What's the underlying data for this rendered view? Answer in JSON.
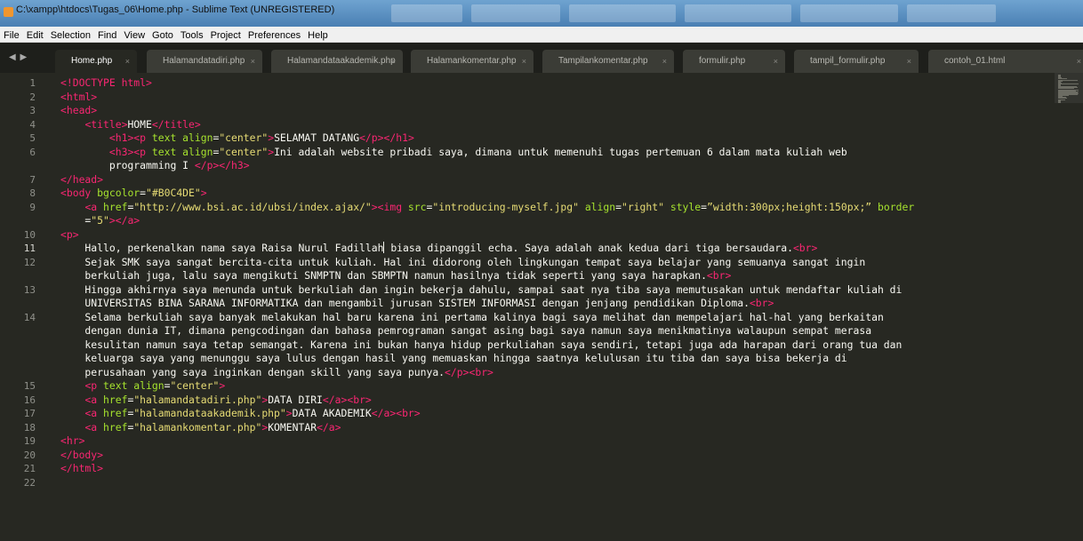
{
  "window": {
    "title": "C:\\xampp\\htdocs\\Tugas_06\\Home.php - Sublime Text (UNREGISTERED)"
  },
  "menu": [
    "File",
    "Edit",
    "Selection",
    "Find",
    "View",
    "Goto",
    "Tools",
    "Project",
    "Preferences",
    "Help"
  ],
  "tabs": [
    {
      "label": "Home.php",
      "active": true
    },
    {
      "label": "Halamandatadiri.php"
    },
    {
      "label": "Halamandataakademik.php"
    },
    {
      "label": "Halamankomentar.php"
    },
    {
      "label": "Tampilankomentar.php"
    },
    {
      "label": "formulir.php"
    },
    {
      "label": "tampil_formulir.php"
    },
    {
      "label": "contoh_01.html"
    }
  ],
  "tab_close_glyph": "×",
  "tab_nav_glyph": "◀ ▶",
  "gutter": [
    "1",
    "2",
    "3",
    "4",
    "5",
    "6",
    "",
    "7",
    "8",
    "9",
    "",
    "10",
    "11",
    "12",
    "",
    "13",
    "",
    "14",
    "",
    "",
    "",
    "",
    "15",
    "16",
    "17",
    "18",
    "19",
    "20",
    "21",
    "22"
  ],
  "current_line": "11",
  "code": [
    [
      [
        "tag",
        "<!DOCTYPE html>"
      ]
    ],
    [
      [
        "tag",
        "<html>"
      ]
    ],
    [
      [
        "tag",
        "<head>"
      ]
    ],
    [
      [
        "txt",
        "    "
      ],
      [
        "tag",
        "<title>"
      ],
      [
        "txt",
        "HOME"
      ],
      [
        "tag",
        "</title>"
      ]
    ],
    [
      [
        "txt",
        "        "
      ],
      [
        "tag",
        "<h1><p "
      ],
      [
        "attr",
        "text align"
      ],
      [
        "txt",
        "="
      ],
      [
        "str",
        "\"center\""
      ],
      [
        "tag",
        ">"
      ],
      [
        "txt",
        "SELAMAT DATANG"
      ],
      [
        "tag",
        "</p></h1>"
      ]
    ],
    [
      [
        "txt",
        "        "
      ],
      [
        "tag",
        "<h3><p "
      ],
      [
        "attr",
        "text align"
      ],
      [
        "txt",
        "="
      ],
      [
        "str",
        "\"center\""
      ],
      [
        "tag",
        ">"
      ],
      [
        "txt",
        "Ini adalah website pribadi saya, dimana untuk memenuhi tugas pertemuan 6 dalam mata kuliah web"
      ]
    ],
    [
      [
        "txt",
        "        programming I "
      ],
      [
        "tag",
        "</p></h3>"
      ]
    ],
    [
      [
        "tag",
        "</head>"
      ]
    ],
    [
      [
        "tag",
        "<body "
      ],
      [
        "attr",
        "bgcolor"
      ],
      [
        "txt",
        "="
      ],
      [
        "str",
        "\"#B0C4DE\""
      ],
      [
        "tag",
        ">"
      ]
    ],
    [
      [
        "txt",
        "    "
      ],
      [
        "tag",
        "<a "
      ],
      [
        "attr",
        "href"
      ],
      [
        "txt",
        "="
      ],
      [
        "str",
        "\"http://www.bsi.ac.id/ubsi/index.ajax/\""
      ],
      [
        "tag",
        "><img "
      ],
      [
        "attr",
        "src"
      ],
      [
        "txt",
        "="
      ],
      [
        "str",
        "\"introducing-myself.jpg\""
      ],
      [
        "txt",
        " "
      ],
      [
        "attr",
        "align"
      ],
      [
        "txt",
        "="
      ],
      [
        "str",
        "\"right\""
      ],
      [
        "txt",
        " "
      ],
      [
        "attr",
        "style"
      ],
      [
        "txt",
        "="
      ],
      [
        "str",
        "”width:300px;height:150px;” "
      ],
      [
        "attr",
        "border"
      ]
    ],
    [
      [
        "txt",
        "    ="
      ],
      [
        "str",
        "\"5\""
      ],
      [
        "tag",
        "></a>"
      ]
    ],
    [
      [
        "tag",
        "<p>"
      ]
    ],
    [
      [
        "txt",
        "    Hallo, perkenalkan nama saya Raisa Nurul Fadillah"
      ],
      [
        "cursor",
        ""
      ],
      [
        "txt",
        " biasa dipanggil echa. Saya adalah anak kedua dari tiga bersaudara."
      ],
      [
        "tag",
        "<br>"
      ]
    ],
    [
      [
        "txt",
        "    Sejak SMK saya sangat bercita-cita untuk kuliah. Hal ini didorong oleh lingkungan tempat saya belajar yang semuanya sangat ingin"
      ]
    ],
    [
      [
        "txt",
        "    berkuliah juga, lalu saya mengikuti SNMPTN dan SBMPTN namun hasilnya tidak seperti yang saya harapkan."
      ],
      [
        "tag",
        "<br>"
      ]
    ],
    [
      [
        "txt",
        "    Hingga akhirnya saya menunda untuk berkuliah dan ingin bekerja dahulu, sampai saat nya tiba saya memutusakan untuk mendaftar kuliah di"
      ]
    ],
    [
      [
        "txt",
        "    UNIVERSITAS BINA SARANA INFORMATIKA dan mengambil jurusan SISTEM INFORMASI dengan jenjang pendidikan Diploma."
      ],
      [
        "tag",
        "<br>"
      ]
    ],
    [
      [
        "txt",
        "    Selama berkuliah saya banyak melakukan hal baru karena ini pertama kalinya bagi saya melihat dan mempelajari hal-hal yang berkaitan"
      ]
    ],
    [
      [
        "txt",
        "    dengan dunia IT, dimana pengcodingan dan bahasa pemrograman sangat asing bagi saya namun saya menikmatinya walaupun sempat merasa"
      ]
    ],
    [
      [
        "txt",
        "    kesulitan namun saya tetap semangat. Karena ini bukan hanya hidup perkuliahan saya sendiri, tetapi juga ada harapan dari orang tua dan"
      ]
    ],
    [
      [
        "txt",
        "    keluarga saya yang menunggu saya lulus dengan hasil yang memuaskan hingga saatnya kelulusan itu tiba dan saya bisa bekerja di"
      ]
    ],
    [
      [
        "txt",
        "    perusahaan yang saya inginkan dengan skill yang saya punya."
      ],
      [
        "tag",
        "</p><br>"
      ]
    ],
    [
      [
        "txt",
        "    "
      ],
      [
        "tag",
        "<p "
      ],
      [
        "attr",
        "text align"
      ],
      [
        "txt",
        "="
      ],
      [
        "str",
        "\"center\""
      ],
      [
        "tag",
        ">"
      ]
    ],
    [
      [
        "txt",
        "    "
      ],
      [
        "tag",
        "<a "
      ],
      [
        "attr",
        "href"
      ],
      [
        "txt",
        "="
      ],
      [
        "str",
        "\"halamandatadiri.php\""
      ],
      [
        "tag",
        ">"
      ],
      [
        "txt",
        "DATA DIRI"
      ],
      [
        "tag",
        "</a><br>"
      ]
    ],
    [
      [
        "txt",
        "    "
      ],
      [
        "tag",
        "<a "
      ],
      [
        "attr",
        "href"
      ],
      [
        "txt",
        "="
      ],
      [
        "str",
        "\"halamandataakademik.php\""
      ],
      [
        "tag",
        ">"
      ],
      [
        "txt",
        "DATA AKADEMIK"
      ],
      [
        "tag",
        "</a><br>"
      ]
    ],
    [
      [
        "txt",
        "    "
      ],
      [
        "tag",
        "<a "
      ],
      [
        "attr",
        "href"
      ],
      [
        "txt",
        "="
      ],
      [
        "str",
        "\"halamankomentar.php\""
      ],
      [
        "tag",
        ">"
      ],
      [
        "txt",
        "KOMENTAR"
      ],
      [
        "tag",
        "</a>"
      ]
    ],
    [
      [
        "tag",
        "<hr>"
      ]
    ],
    [
      [
        "tag",
        "</body>"
      ]
    ],
    [
      [
        "tag",
        "</html>"
      ]
    ],
    []
  ],
  "colors": {
    "editor_bg": "#272822",
    "tag": "#f92672",
    "attribute": "#a6e22e",
    "string": "#e6db74",
    "text": "#f8f8f2",
    "line_number": "#8f908a",
    "titlebar": "#5b8fc2"
  },
  "icons": {
    "app": "sublime-text-icon",
    "tab_close": "close-icon",
    "tab_nav": "tab-scroll-arrows-icon"
  }
}
